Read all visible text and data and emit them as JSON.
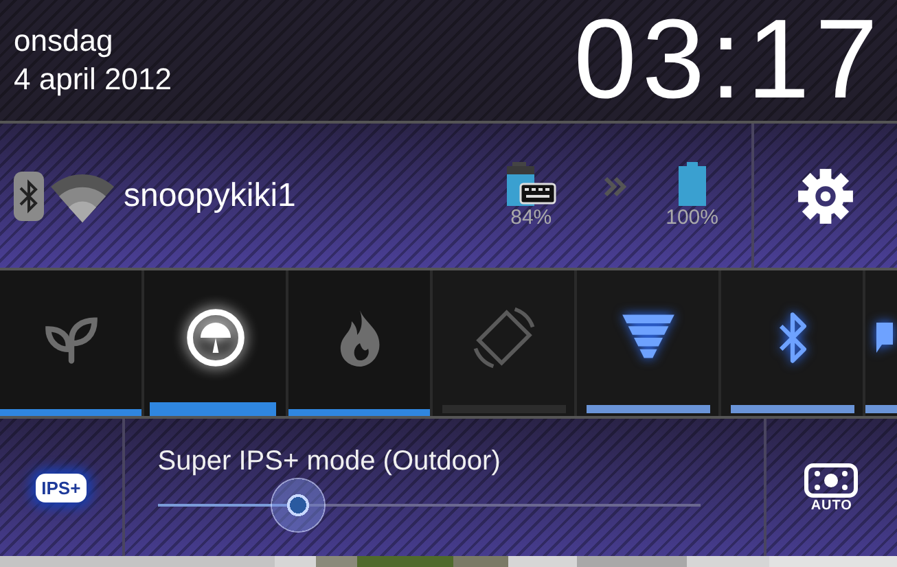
{
  "header": {
    "day": "onsdag",
    "date": "4 april 2012",
    "time": "03:17"
  },
  "status": {
    "network": "snoopykiki1",
    "dock_battery": "84%",
    "battery": "100%"
  },
  "modes": [
    {
      "kind": "leaf",
      "selected": false
    },
    {
      "kind": "gauge",
      "selected": true
    },
    {
      "kind": "flame",
      "selected": false
    }
  ],
  "switches": [
    {
      "kind": "rotate",
      "on": false
    },
    {
      "kind": "signal",
      "on": true
    },
    {
      "kind": "bluetooth",
      "on": true
    },
    {
      "kind": "partial",
      "on": true
    }
  ],
  "display": {
    "badge": "IPS+",
    "label": "Super IPS+ mode (Outdoor)",
    "level": 0.26,
    "auto_label": "AUTO"
  }
}
